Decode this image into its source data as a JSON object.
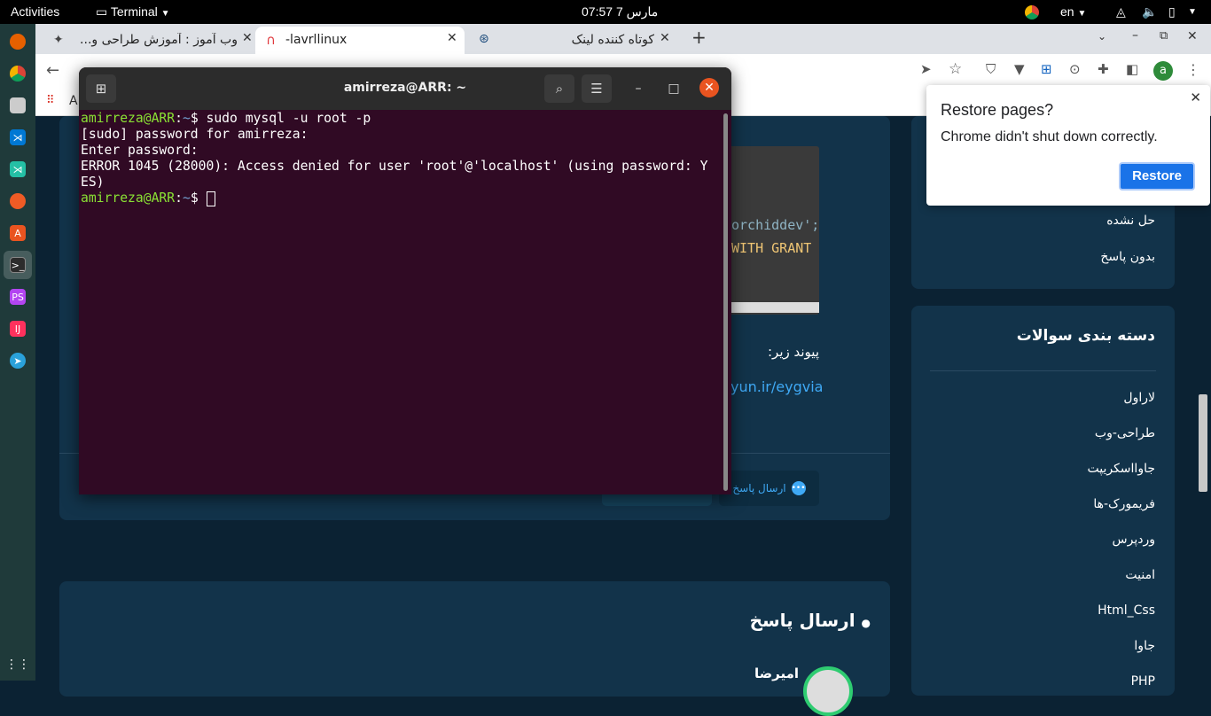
{
  "topbar": {
    "activities": "Activities",
    "app_menu": "Terminal",
    "clock": "07:57  مارس 7",
    "lang": "en"
  },
  "dock": {
    "apps": [
      "firefox-icon",
      "chrome-icon",
      "files-icon",
      "vscode-icon",
      "vscode-insiders-icon",
      "postman-icon",
      "software-icon",
      "terminal-icon",
      "phpstorm-icon",
      "intellij-icon",
      "telegram-icon",
      "app-grid-icon"
    ]
  },
  "chrome": {
    "tabs": [
      {
        "title": "وب آموز : آموزش طراحی و..."
      },
      {
        "title": "-lavrllinux"
      },
      {
        "title": "کوتاه کننده لینک"
      }
    ],
    "new_tab": "+",
    "bookmark_letter": "A",
    "profile_letter": "a"
  },
  "page": {
    "code_line1": "orchiddev';",
    "code_line2": "WITH GRANT",
    "link_label": "پیوند زیر:",
    "short_link": "yun.ir/eygvia",
    "send_reply_button": "ارسال پاسخ",
    "reply_heading": "ارسال پاسخ",
    "user_name": "امیرضا",
    "sidebar_filters": [
      "حل نشده",
      "بدون پاسخ"
    ],
    "categories_title": "دسته بندی سوالات",
    "categories": [
      "لاراول",
      "طراحی-وب",
      "جاوااسکریپت",
      "فریمورک-ها",
      "وردپرس",
      "امنیت",
      "Html_Css",
      "جاوا",
      "PHP"
    ]
  },
  "terminal": {
    "title": "amirreza@ARR: ~",
    "prompt_user": "amirreza@ARR",
    "prompt_path": "~",
    "command": "sudo mysql -u root -p",
    "lines": [
      "[sudo] password for amirreza:",
      "Enter password:",
      "ERROR 1045 (28000): Access denied for user 'root'@'localhost' (using password: Y",
      "ES)"
    ]
  },
  "restore_popup": {
    "title": "Restore pages?",
    "message": "Chrome didn't shut down correctly.",
    "button": "Restore"
  },
  "colors": {
    "terminal_bg": "#300a24",
    "prompt_green": "#8ae234",
    "prompt_blue": "#729fcf",
    "restore_blue": "#1a73e8",
    "page_bg": "#0b2233"
  }
}
